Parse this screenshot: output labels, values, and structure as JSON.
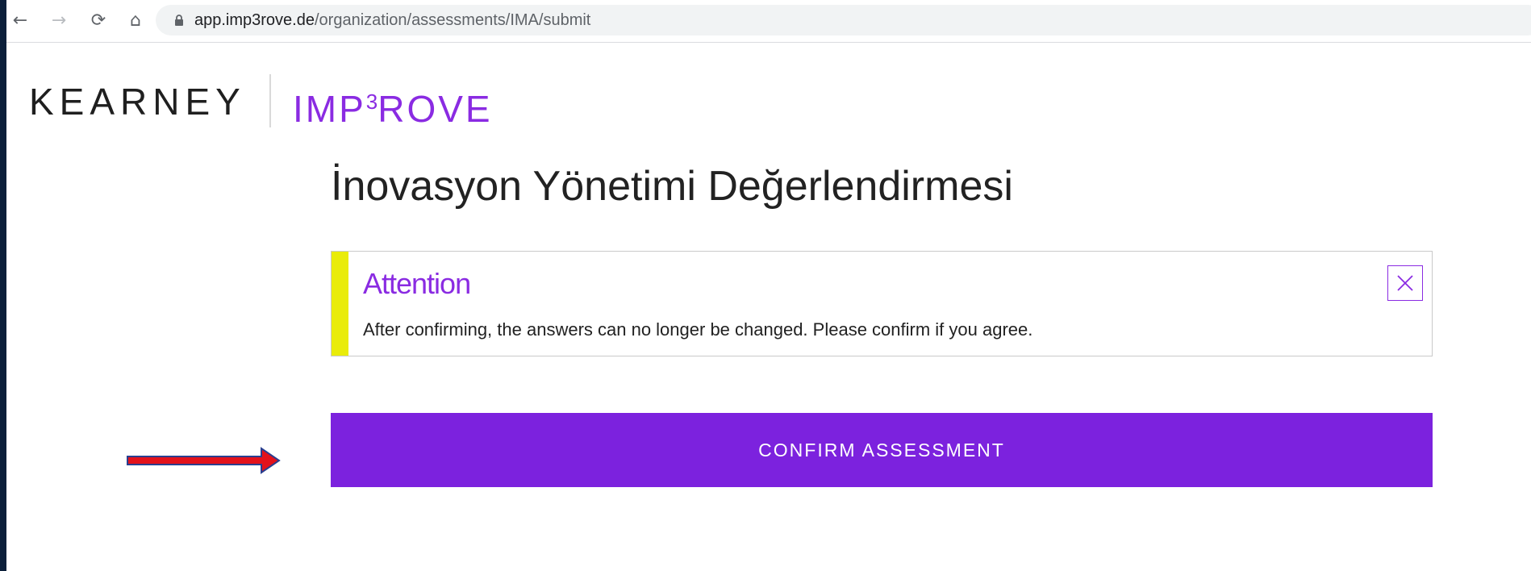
{
  "browser": {
    "url_host": "app.imp3rove.de",
    "url_path": "/organization/assessments/IMA/submit",
    "back_glyph": "←",
    "forward_glyph": "→",
    "reload_glyph": "⟳",
    "home_glyph": "⌂"
  },
  "logo": {
    "kearney": "KEARNEY",
    "improve_prefix": "IMP",
    "improve_sup": "3",
    "improve_suffix": "ROVE"
  },
  "page": {
    "title": "İnovasyon Yönetimi Değerlendirmesi"
  },
  "alert": {
    "title": "Attention",
    "message": "After confirming, the answers can no longer be changed. Please confirm if you agree."
  },
  "actions": {
    "confirm_label": "CONFIRM ASSESSMENT"
  },
  "colors": {
    "brand_purple": "#7c22de",
    "accent_purple": "#8a2be2",
    "alert_bar_yellow": "#e9ec0a",
    "annotation_red": "#e3121b",
    "annotation_outline": "#2a3f8f"
  },
  "icons": {
    "back": "back-arrow-icon",
    "forward": "forward-arrow-icon",
    "reload": "reload-icon",
    "home": "home-icon",
    "lock": "lock-icon",
    "close": "close-icon",
    "annotation": "red-arrow-icon"
  }
}
